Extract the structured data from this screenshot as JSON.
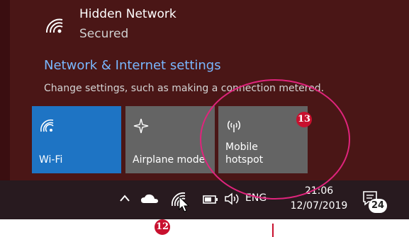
{
  "network": {
    "name": "Hidden Network",
    "status": "Secured"
  },
  "settings": {
    "link_label": "Network & Internet settings",
    "description": "Change settings, such as making a connection metered."
  },
  "quick_actions": [
    {
      "label": "Wi-Fi",
      "icon": "wifi-icon",
      "active": true
    },
    {
      "label": "Airplane mode",
      "icon": "airplane-icon",
      "active": false
    },
    {
      "label": "Mobile hotspot",
      "icon": "hotspot-icon",
      "active": false
    }
  ],
  "taskbar": {
    "language": "ENG",
    "time": "21:06",
    "date": "12/07/2019",
    "notification_count": "24"
  },
  "annotations": {
    "callout_12": "12",
    "callout_13": "13"
  },
  "colors": {
    "flyout_bg": "#4a1616",
    "active_tile": "#1e74c4",
    "inactive_tile": "#646464",
    "link": "#79b7ff",
    "annotation": "#e0247c"
  }
}
